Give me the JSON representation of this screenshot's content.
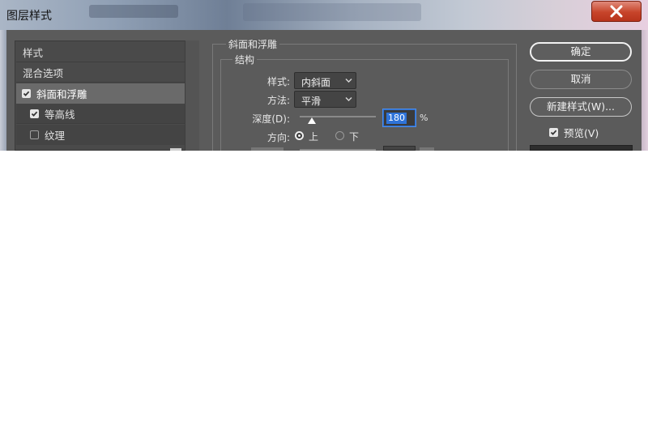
{
  "window": {
    "title": "图层样式"
  },
  "left_panel": {
    "items": [
      {
        "label": "样式",
        "checked": null,
        "selected": false,
        "sub": false
      },
      {
        "label": "混合选项",
        "checked": null,
        "selected": false,
        "sub": false
      },
      {
        "label": "斜面和浮雕",
        "checked": true,
        "selected": true,
        "sub": false
      },
      {
        "label": "等高线",
        "checked": true,
        "selected": false,
        "sub": true
      },
      {
        "label": "纹理",
        "checked": false,
        "selected": false,
        "sub": true
      }
    ]
  },
  "bevel": {
    "group_title": "斜面和浮雕",
    "section_title": "结构",
    "style_label": "样式:",
    "style_value": "内斜面",
    "technique_label": "方法:",
    "technique_value": "平滑",
    "depth_label": "深度(D):",
    "depth_value": "180",
    "depth_unit": "%",
    "direction_label": "方向:",
    "direction_up": "上",
    "direction_down": "下",
    "direction_selected": "上"
  },
  "buttons": {
    "ok": "确定",
    "cancel": "取消",
    "new_style": "新建样式(W)...",
    "preview": "预览(V)",
    "preview_checked": true
  },
  "colors": {
    "dialog_bg": "#5b5b5b",
    "selected_row": "#6a6a6a",
    "accent": "#2f73d8",
    "close_button": "#c7442a"
  }
}
